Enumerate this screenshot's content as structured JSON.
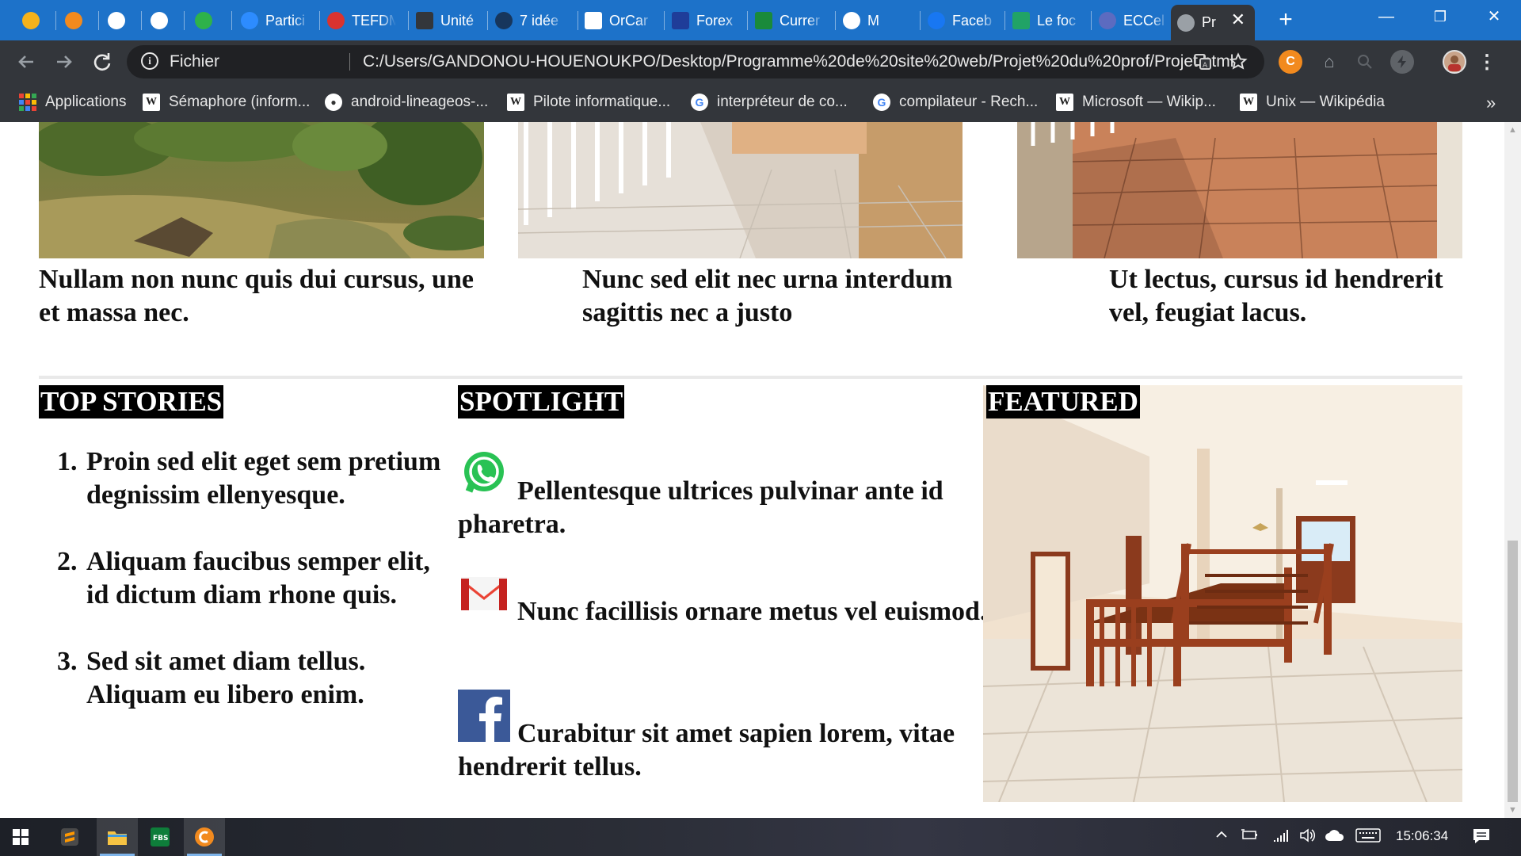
{
  "browser": {
    "tabs": [
      {
        "title": "",
        "icon": "sublime-icon",
        "color": "#f5b21b"
      },
      {
        "title": "",
        "icon": "ccleaner-icon",
        "color": "#f28a1e"
      },
      {
        "title": "",
        "icon": "google-icon",
        "color": "#ffffff"
      },
      {
        "title": "",
        "icon": "gmail-icon",
        "color": "#ffffff"
      },
      {
        "title": "",
        "icon": "tab-1-icon",
        "color": "#2eb24a"
      },
      {
        "title": "Partici",
        "icon": "zoom-icon",
        "color": "#2d8cff"
      },
      {
        "title": "TEFDM",
        "icon": "tefdm-icon",
        "color": "#d9332f"
      },
      {
        "title": "Unité",
        "icon": "gt-icon",
        "color": "#33363b"
      },
      {
        "title": "7 idée",
        "icon": "circle-icon",
        "color": "#17365c"
      },
      {
        "title": "OrCar",
        "icon": "amazon-icon",
        "color": "#ffffff"
      },
      {
        "title": "Forex",
        "icon": "eu-icon",
        "color": "#1f3d99"
      },
      {
        "title": "Currer",
        "icon": "fbs-icon",
        "color": "#1a8a3a"
      },
      {
        "title": "M",
        "icon": "gmail-star-icon",
        "color": "#ffffff"
      },
      {
        "title": "Faceb",
        "icon": "facebook-icon",
        "color": "#1877f2"
      },
      {
        "title": "Le foc",
        "icon": "sheet-icon",
        "color": "#21a366"
      },
      {
        "title": "ECCel",
        "icon": "globe-icon",
        "color": "#5c6bc0"
      },
      {
        "title": "Pr",
        "icon": "globe-gray-icon",
        "color": "#9aa0a6"
      }
    ],
    "new_tab_label": "+",
    "window_controls": {
      "minimize": "—",
      "restore": "❐",
      "close": "✕"
    },
    "address_bar": {
      "scheme_label": "Fichier",
      "url": "C:/Users/GANDONOU-HOUENOUKPO/Desktop/Programme%20de%20site%20web/Projet%20du%20prof/Projet.html"
    },
    "bookmarks": [
      {
        "label": "Applications",
        "icon": "apps-grid-icon"
      },
      {
        "label": "Sémaphore (inform...",
        "icon": "wikipedia-icon"
      },
      {
        "label": "android-lineageos-...",
        "icon": "github-icon"
      },
      {
        "label": "Pilote informatique...",
        "icon": "wikipedia-icon"
      },
      {
        "label": "interpréteur de co...",
        "icon": "google-icon"
      },
      {
        "label": "compilateur - Rech...",
        "icon": "google-icon"
      },
      {
        "label": "Microsoft — Wikip...",
        "icon": "wikipedia-icon"
      },
      {
        "label": "Unix — Wikipédia",
        "icon": "wikipedia-icon"
      }
    ],
    "bookmarks_overflow": "»"
  },
  "page": {
    "top_cards": [
      {
        "caption": "Nullam non nunc quis dui cursus, une et massa nec.",
        "image": "landscape-photo"
      },
      {
        "caption": "Nunc sed elit nec urna interdum sagittis nec a justo",
        "image": "balcony-tiles-photo"
      },
      {
        "caption": "Ut lectus, cursus id hendrerit vel, feugiat lacus.",
        "image": "terrace-tiles-photo"
      }
    ],
    "top_stories": {
      "heading": "TOP STORIES",
      "items": [
        {
          "num": "1.",
          "text": "Proin sed elit eget sem pretium degnissim ellenyesque."
        },
        {
          "num": "2.",
          "text": "Aliquam faucibus semper elit, id dictum diam rhone quis."
        },
        {
          "num": "3.",
          "text": "Sed sit amet diam tellus. Aliquam eu libero enim."
        }
      ]
    },
    "spotlight": {
      "heading": "SPOTLIGHT",
      "items": [
        {
          "icon": "whatsapp-icon",
          "text": "Pellentesque ultrices pulvinar ante id pharetra."
        },
        {
          "icon": "gmail-icon",
          "text": "Nunc facillisis ornare metus vel euismod."
        },
        {
          "icon": "facebook-icon",
          "text": "Curabitur sit amet sapien lorem, vitae hendrerit tellus."
        }
      ]
    },
    "featured": {
      "heading": "FEATURED",
      "image": "staircase-interior-photo"
    }
  },
  "taskbar": {
    "apps": [
      "sublime-text-icon",
      "file-explorer-icon",
      "fbs-trader-icon",
      "ccleaner-icon"
    ],
    "clock": "15:06:34"
  }
}
